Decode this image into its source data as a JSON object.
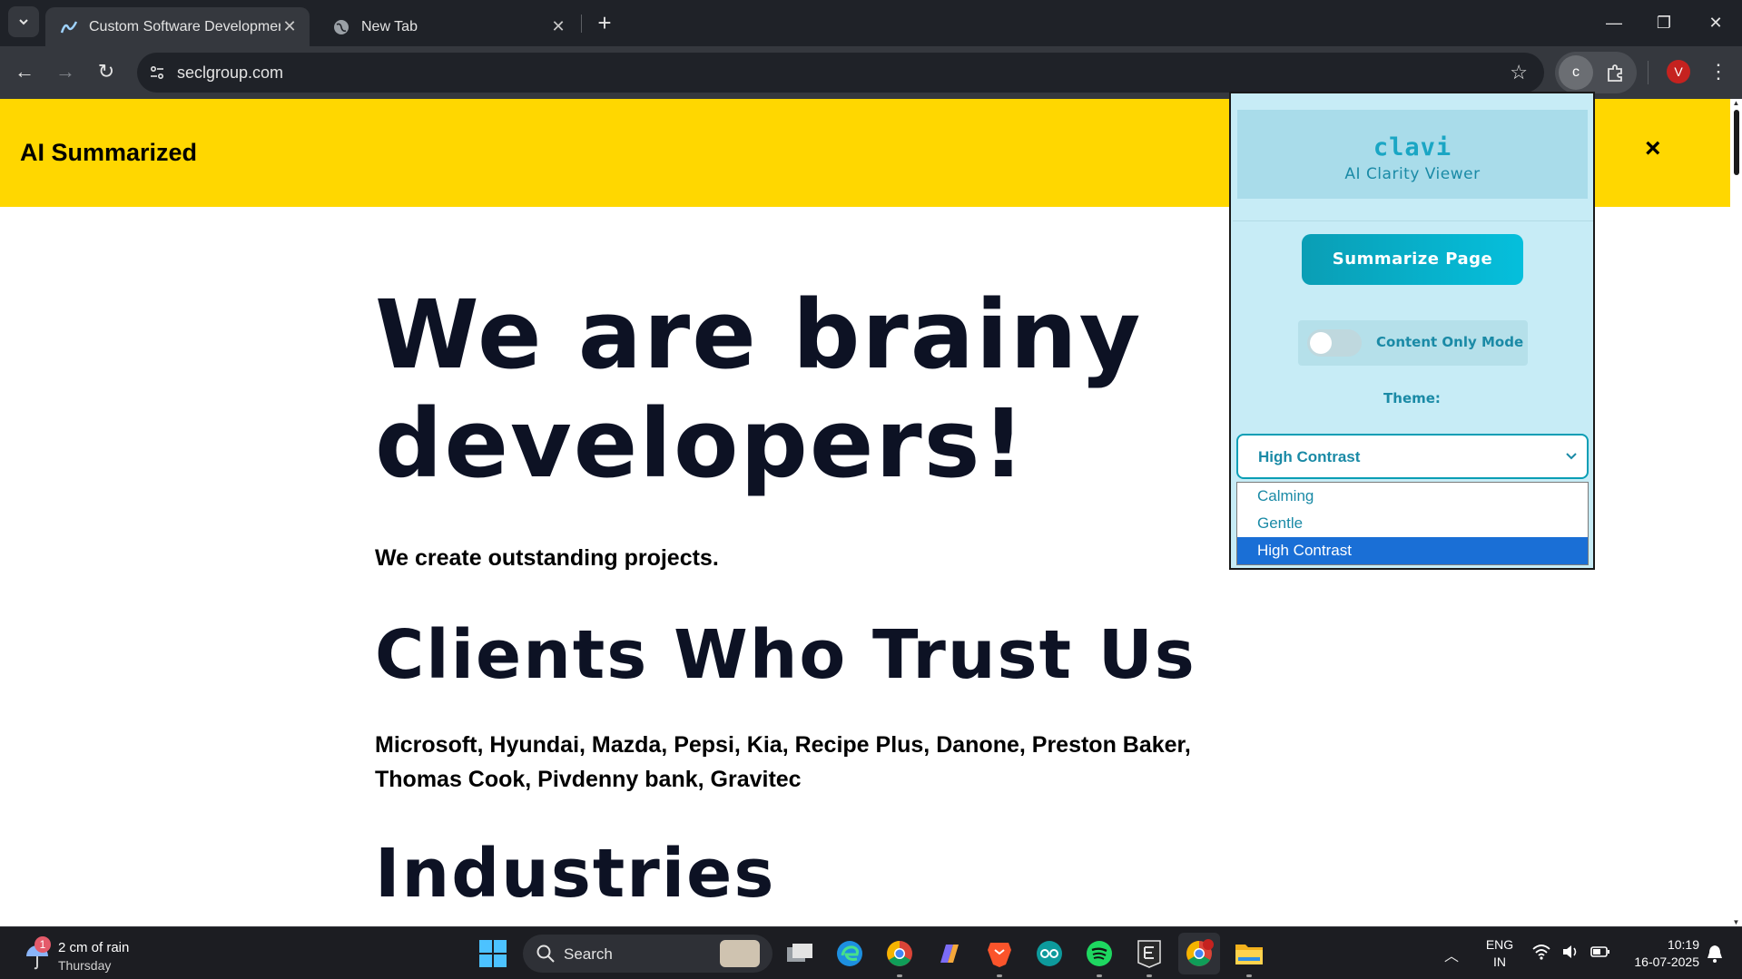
{
  "browser": {
    "tabs": [
      {
        "title": "Custom Software Development",
        "active": true,
        "favicon": "seclgroup-logo-icon"
      },
      {
        "title": "New Tab",
        "active": false,
        "favicon": "globe-icon"
      }
    ],
    "url": "seclgroup.com",
    "extension_letter": "c",
    "profile_initial": "V"
  },
  "banner": {
    "title": "AI Summarized",
    "close_symbol": "×",
    "background": "#ffd700"
  },
  "page": {
    "hero_line1": "We are brainy",
    "hero_line2": "developers!",
    "subline": "We create outstanding projects.",
    "clients_heading": "Clients Who Trust Us",
    "clients_list": "Microsoft, Hyundai, Mazda, Pepsi, Kia, Recipe Plus, Danone, Preston Baker, Thomas Cook, Pivdenny bank, Gravitec",
    "industries_heading": "Industries"
  },
  "popup": {
    "brand": "clavi",
    "subtitle": "AI Clarity Viewer",
    "summarize_label": "Summarize Page",
    "content_only_label": "Content Only Mode",
    "content_only_enabled": false,
    "theme_label": "Theme:",
    "theme_selected": "High Contrast",
    "theme_options": [
      "Calming",
      "Gentle",
      "High Contrast"
    ],
    "accent": "#0a9eb5"
  },
  "taskbar": {
    "weather_badge": "1",
    "weather_text": "2 cm of rain",
    "weather_day": "Thursday",
    "search_placeholder": "Search",
    "lang_line1": "ENG",
    "lang_line2": "IN",
    "time": "10:19",
    "date": "16-07-2025",
    "apps": [
      "task-view",
      "edge",
      "chrome",
      "copilot",
      "brave",
      "arduino",
      "spotify",
      "epic-games",
      "chrome-profile",
      "file-explorer"
    ]
  }
}
